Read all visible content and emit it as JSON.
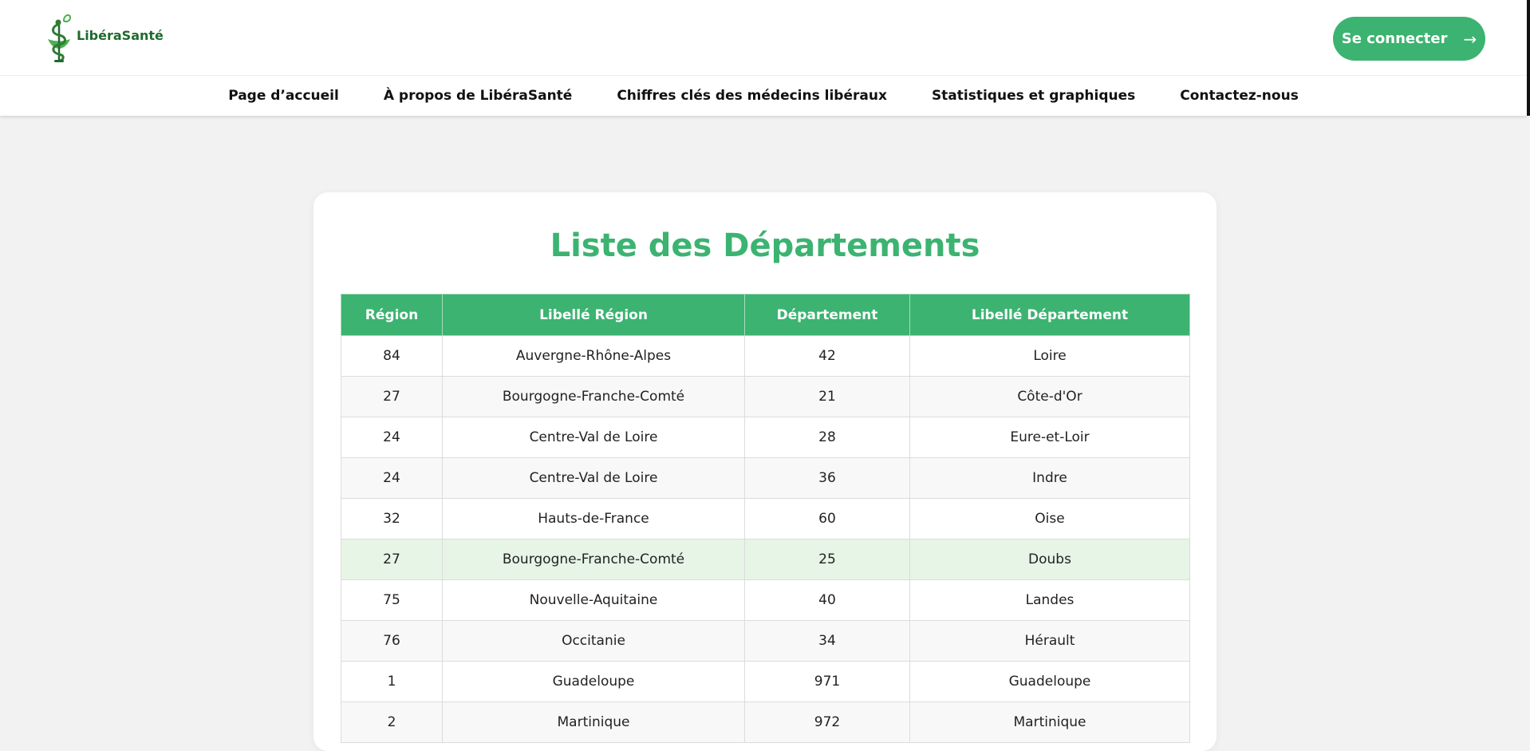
{
  "brand": {
    "name": "LibéraSanté"
  },
  "header": {
    "login_label": "Se connecter",
    "login_arrow": "→"
  },
  "nav": {
    "items": [
      {
        "label": "Page d’accueil"
      },
      {
        "label": "À propos de LibéraSanté"
      },
      {
        "label": "Chiffres clés des médecins libéraux"
      },
      {
        "label": "Statistiques et graphiques"
      },
      {
        "label": "Contactez-nous"
      }
    ]
  },
  "main": {
    "title": "Liste des Départements",
    "columns": [
      "Région",
      "Libellé Région",
      "Département",
      "Libellé Département"
    ],
    "rows": [
      [
        "84",
        "Auvergne-Rhône-Alpes",
        "42",
        "Loire"
      ],
      [
        "27",
        "Bourgogne-Franche-Comté",
        "21",
        "Côte-d'Or"
      ],
      [
        "24",
        "Centre-Val de Loire",
        "28",
        "Eure-et-Loir"
      ],
      [
        "24",
        "Centre-Val de Loire",
        "36",
        "Indre"
      ],
      [
        "32",
        "Hauts-de-France",
        "60",
        "Oise"
      ],
      [
        "27",
        "Bourgogne-Franche-Comté",
        "25",
        "Doubs"
      ],
      [
        "75",
        "Nouvelle-Aquitaine",
        "40",
        "Landes"
      ],
      [
        "76",
        "Occitanie",
        "34",
        "Hérault"
      ],
      [
        "1",
        "Guadeloupe",
        "971",
        "Guadeloupe"
      ],
      [
        "2",
        "Martinique",
        "972",
        "Martinique"
      ]
    ]
  },
  "colors": {
    "accent": "#3cb371",
    "logo_dark": "#1e6a2e",
    "row_highlight": "#e6f5e6",
    "row_even": "#f8f8f8"
  }
}
